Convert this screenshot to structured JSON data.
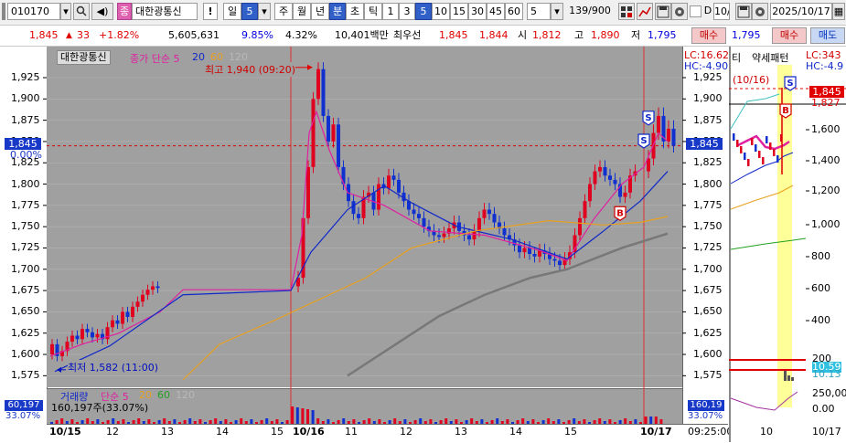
{
  "toolbar": {
    "code": "010170",
    "stock_name": "대한광통신",
    "jong_label": "종",
    "excl_label": "!",
    "day_label": "일",
    "day_value": "5",
    "periods": [
      "주",
      "월",
      "년",
      "분",
      "초",
      "틱"
    ],
    "intervals": [
      "1",
      "3",
      "5",
      "10",
      "15",
      "30",
      "45",
      "60"
    ],
    "active_interval": "5",
    "count_value": "5",
    "page_counter": "139/900",
    "checkbox_label": "D",
    "right_code_partial": "10/",
    "right_date": "2025/10/17"
  },
  "quote": {
    "price": "1,845",
    "change_arrow": "▲",
    "change": "33",
    "change_pct": "+1.82%",
    "volume": "5,605,631",
    "turnover": "9.85%",
    "ratio": "4.32%",
    "amount": "10,401백만",
    "best_ask_label": "최우선",
    "best_ask": "1,845",
    "best_bid": "1,844",
    "open_label": "시",
    "open": "1,812",
    "high_label": "고",
    "high": "1,890",
    "low_label": "저",
    "low": "1,795",
    "buy_button": "매수",
    "right_price": "1,795",
    "right_buy": "매수",
    "right_sell": "매도"
  },
  "main_chart": {
    "legend_name": "대한광통신",
    "legend_ma_label": "종가 단순 5",
    "legend_ma": [
      "20",
      "60",
      "120"
    ],
    "high_annotation": "최고 1,940 (09:20)",
    "low_annotation": "최저 1,582 (11:00)",
    "lc_label": "LC:16.62",
    "hc_label": "HC:-4.90",
    "cur_price_tag": "1,845",
    "cur_pct_tag": "0.00%",
    "right_price_tag": "1,845",
    "y_ticks": [
      "1,925",
      "1,900",
      "1,875",
      "1,850",
      "1,825",
      "1,800",
      "1,775",
      "1,750",
      "1,725",
      "1,700",
      "1,675",
      "1,650",
      "1,625",
      "1,600",
      "1,575"
    ],
    "x_labels": [
      "10/15",
      "12",
      "13",
      "14",
      "15",
      "10/16",
      "11",
      "12",
      "13",
      "14",
      "15",
      "10/17",
      "09:25:00"
    ],
    "signal_s": "S",
    "signal_b": "B"
  },
  "volume_chart": {
    "legend_label": "거래량",
    "legend_ma_label": "단순 5",
    "legend_ma": [
      "20",
      "60",
      "120"
    ],
    "value_text": "160,197주(33.07%)",
    "left_tag1": "60,197",
    "left_tag2": "33.07%",
    "right_tag1": "160,19",
    "right_tag2": "33.07%"
  },
  "side_chart": {
    "title_left": "티",
    "title": "약세패턴",
    "lc_label": "LC:343",
    "hc_label": "HC:-4.9",
    "date_annot": "(10/16)",
    "price_tag": "1,845",
    "price_tag2": "1,827",
    "y_ticks": [
      "1,600",
      "1,400",
      "1,200",
      "1,000",
      "800",
      "600",
      "400"
    ],
    "y_ticks_low": [
      "200",
      "10.59",
      "10.13",
      "250,00",
      "0.00"
    ],
    "x_labels": [
      "10",
      "10/17"
    ],
    "signal_s": "S",
    "signal_b": "B"
  },
  "colors": {
    "plot_bg": "#a0a0a0",
    "up_candle": "#e00020",
    "down_candle": "#1030d0",
    "ma5": "#e020a0",
    "ma20": "#1028c8",
    "ma60": "#e8a020",
    "ma120": "#787878",
    "accent_blue": "#3060c8"
  }
}
